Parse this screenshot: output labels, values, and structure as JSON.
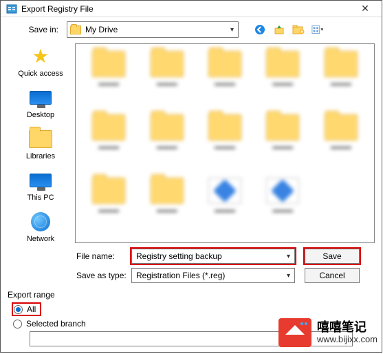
{
  "title": "Export Registry File",
  "savein": {
    "label": "Save in:",
    "value": "My Drive"
  },
  "places": [
    {
      "key": "quick-access",
      "label": "Quick access",
      "icon": "star"
    },
    {
      "key": "desktop",
      "label": "Desktop",
      "icon": "monitor"
    },
    {
      "key": "libraries",
      "label": "Libraries",
      "icon": "folder"
    },
    {
      "key": "this-pc",
      "label": "This PC",
      "icon": "monitor"
    },
    {
      "key": "network",
      "label": "Network",
      "icon": "globe"
    }
  ],
  "nav_icons": [
    "back-icon",
    "up-icon",
    "new-folder-icon",
    "view-menu-icon"
  ],
  "filename": {
    "label": "File name:",
    "value": "Registry setting backup"
  },
  "savetype": {
    "label": "Save as type:",
    "value": "Registration Files (*.reg)"
  },
  "buttons": {
    "save": "Save",
    "cancel": "Cancel"
  },
  "export_range": {
    "group_label": "Export range",
    "all_label": "All",
    "branch_label": "Selected branch",
    "selected": "all",
    "branch_value": ""
  },
  "watermark": {
    "line1": "嘻嘻笔记",
    "line2": "www.bijixx.com"
  }
}
